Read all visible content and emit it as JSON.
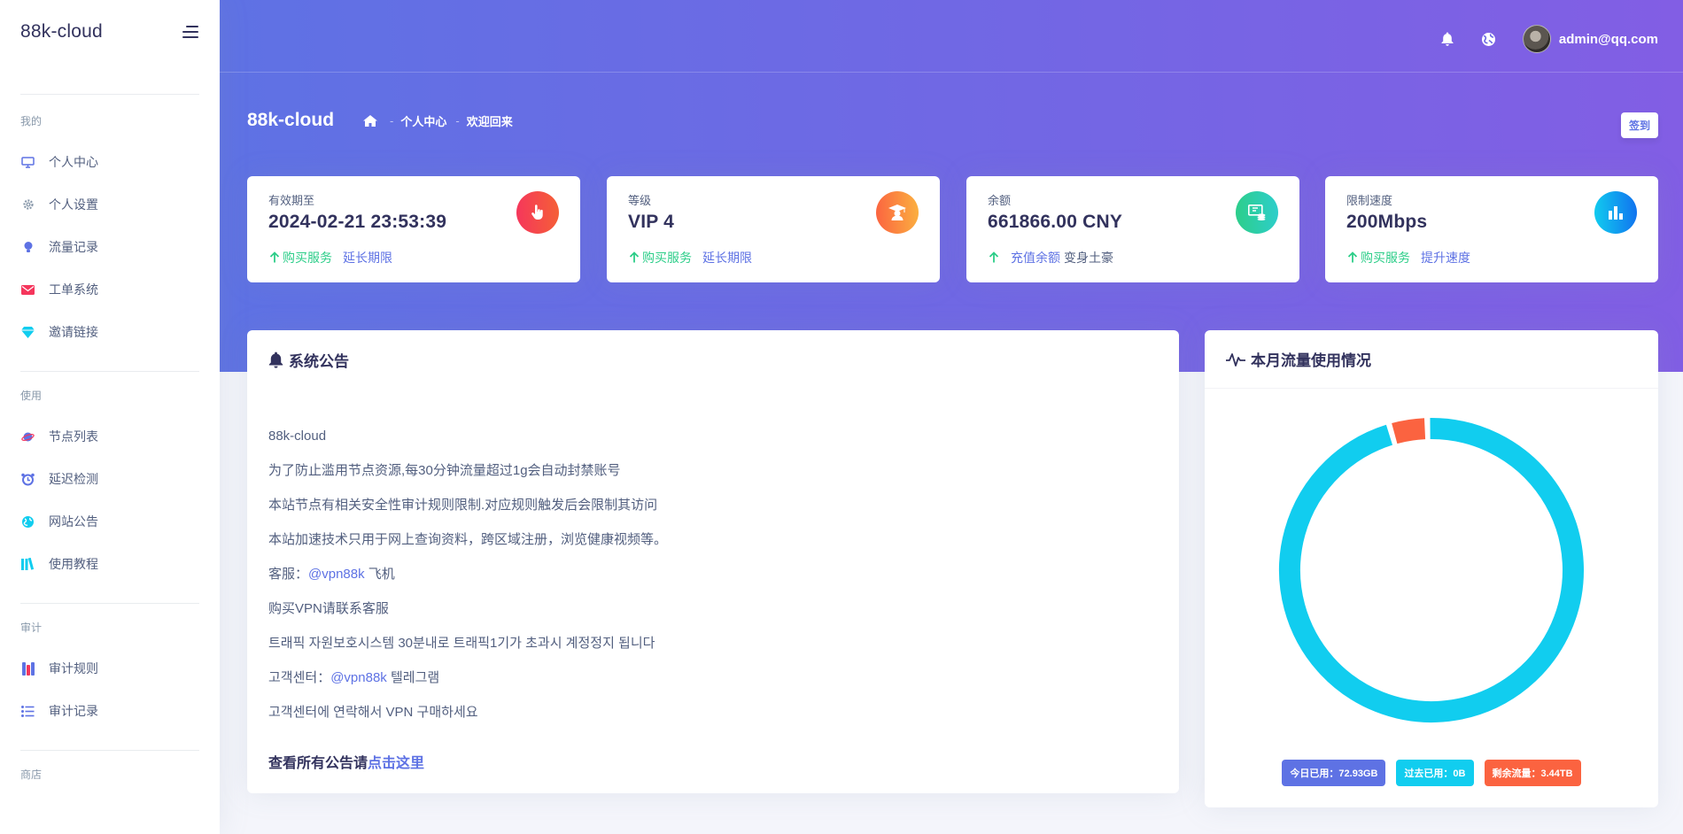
{
  "sidebar": {
    "brand": "88k-cloud",
    "sections": [
      {
        "title": "我的",
        "items": [
          "个人中心",
          "个人设置",
          "流量记录",
          "工单系统",
          "邀请链接"
        ]
      },
      {
        "title": "使用",
        "items": [
          "节点列表",
          "延迟检测",
          "网站公告",
          "使用教程"
        ]
      },
      {
        "title": "审计",
        "items": [
          "审计规则",
          "审计记录"
        ]
      },
      {
        "title": "商店",
        "items": []
      }
    ]
  },
  "topbar": {
    "user": "admin@qq.com"
  },
  "header": {
    "title": "88k-cloud",
    "breadcrumb": [
      "个人中心",
      "欢迎回来"
    ],
    "sign_button": "签到"
  },
  "stats": [
    {
      "label": "有效期至",
      "value": "2024-02-21 23:53:39",
      "link1": "购买服务",
      "link2": "延长期限",
      "color": "#f5365c"
    },
    {
      "label": "等级",
      "value": "VIP 4",
      "link1": "购买服务",
      "link2": "延长期限",
      "color": "#fb6340"
    },
    {
      "label": "余额",
      "value": "661866.00 CNY",
      "link1": "充值余额",
      "link2": "变身土豪",
      "color": "#2dce89"
    },
    {
      "label": "限制速度",
      "value": "200Mbps",
      "link1": "购买服务",
      "link2": "提升速度",
      "color": "#11cdef"
    }
  ],
  "notice": {
    "title": "系统公告",
    "lines": [
      "88k-cloud",
      "为了防止滥用节点资源,每30分钟流量超过1g会自动封禁账号",
      "本站节点有相关安全性审计规则限制.对应规则触发后会限制其访问",
      "本站加速技术只用于网上查询资料，跨区域注册，浏览健康视频等。"
    ],
    "service_prefix": "客服：",
    "service_handle": "@vpn88k",
    "service_suffix": " 飞机",
    "buy_vpn": "购买VPN请联系客服",
    "kr_line1": "트래픽 자원보호시스템 30분내로 트래픽1기가 초과시 계정정지 됩니다",
    "kr_service_prefix": "고객센터：",
    "kr_service_handle": "@vpn88k",
    "kr_service_suffix": " 텔레그램",
    "kr_line2": "고객센터에 연락해서 VPN 구매하세요",
    "all_prefix": "查看所有公告请",
    "all_link": "点击这里"
  },
  "traffic": {
    "title": "本月流量使用情况",
    "today_label": "今日已用：72.93GB",
    "past_label": "过去已用：0B",
    "remain_label": "剩余流量：3.44TB",
    "colors": {
      "today": "#5e72e4",
      "past": "#11cdef",
      "remain": "#fb6340"
    },
    "chart_data": {
      "type": "pie",
      "donut": true,
      "categories": [
        "今日已用",
        "过去已用",
        "剩余流量"
      ],
      "values": [
        72.93,
        0,
        3522.56
      ],
      "units": "GB"
    }
  }
}
